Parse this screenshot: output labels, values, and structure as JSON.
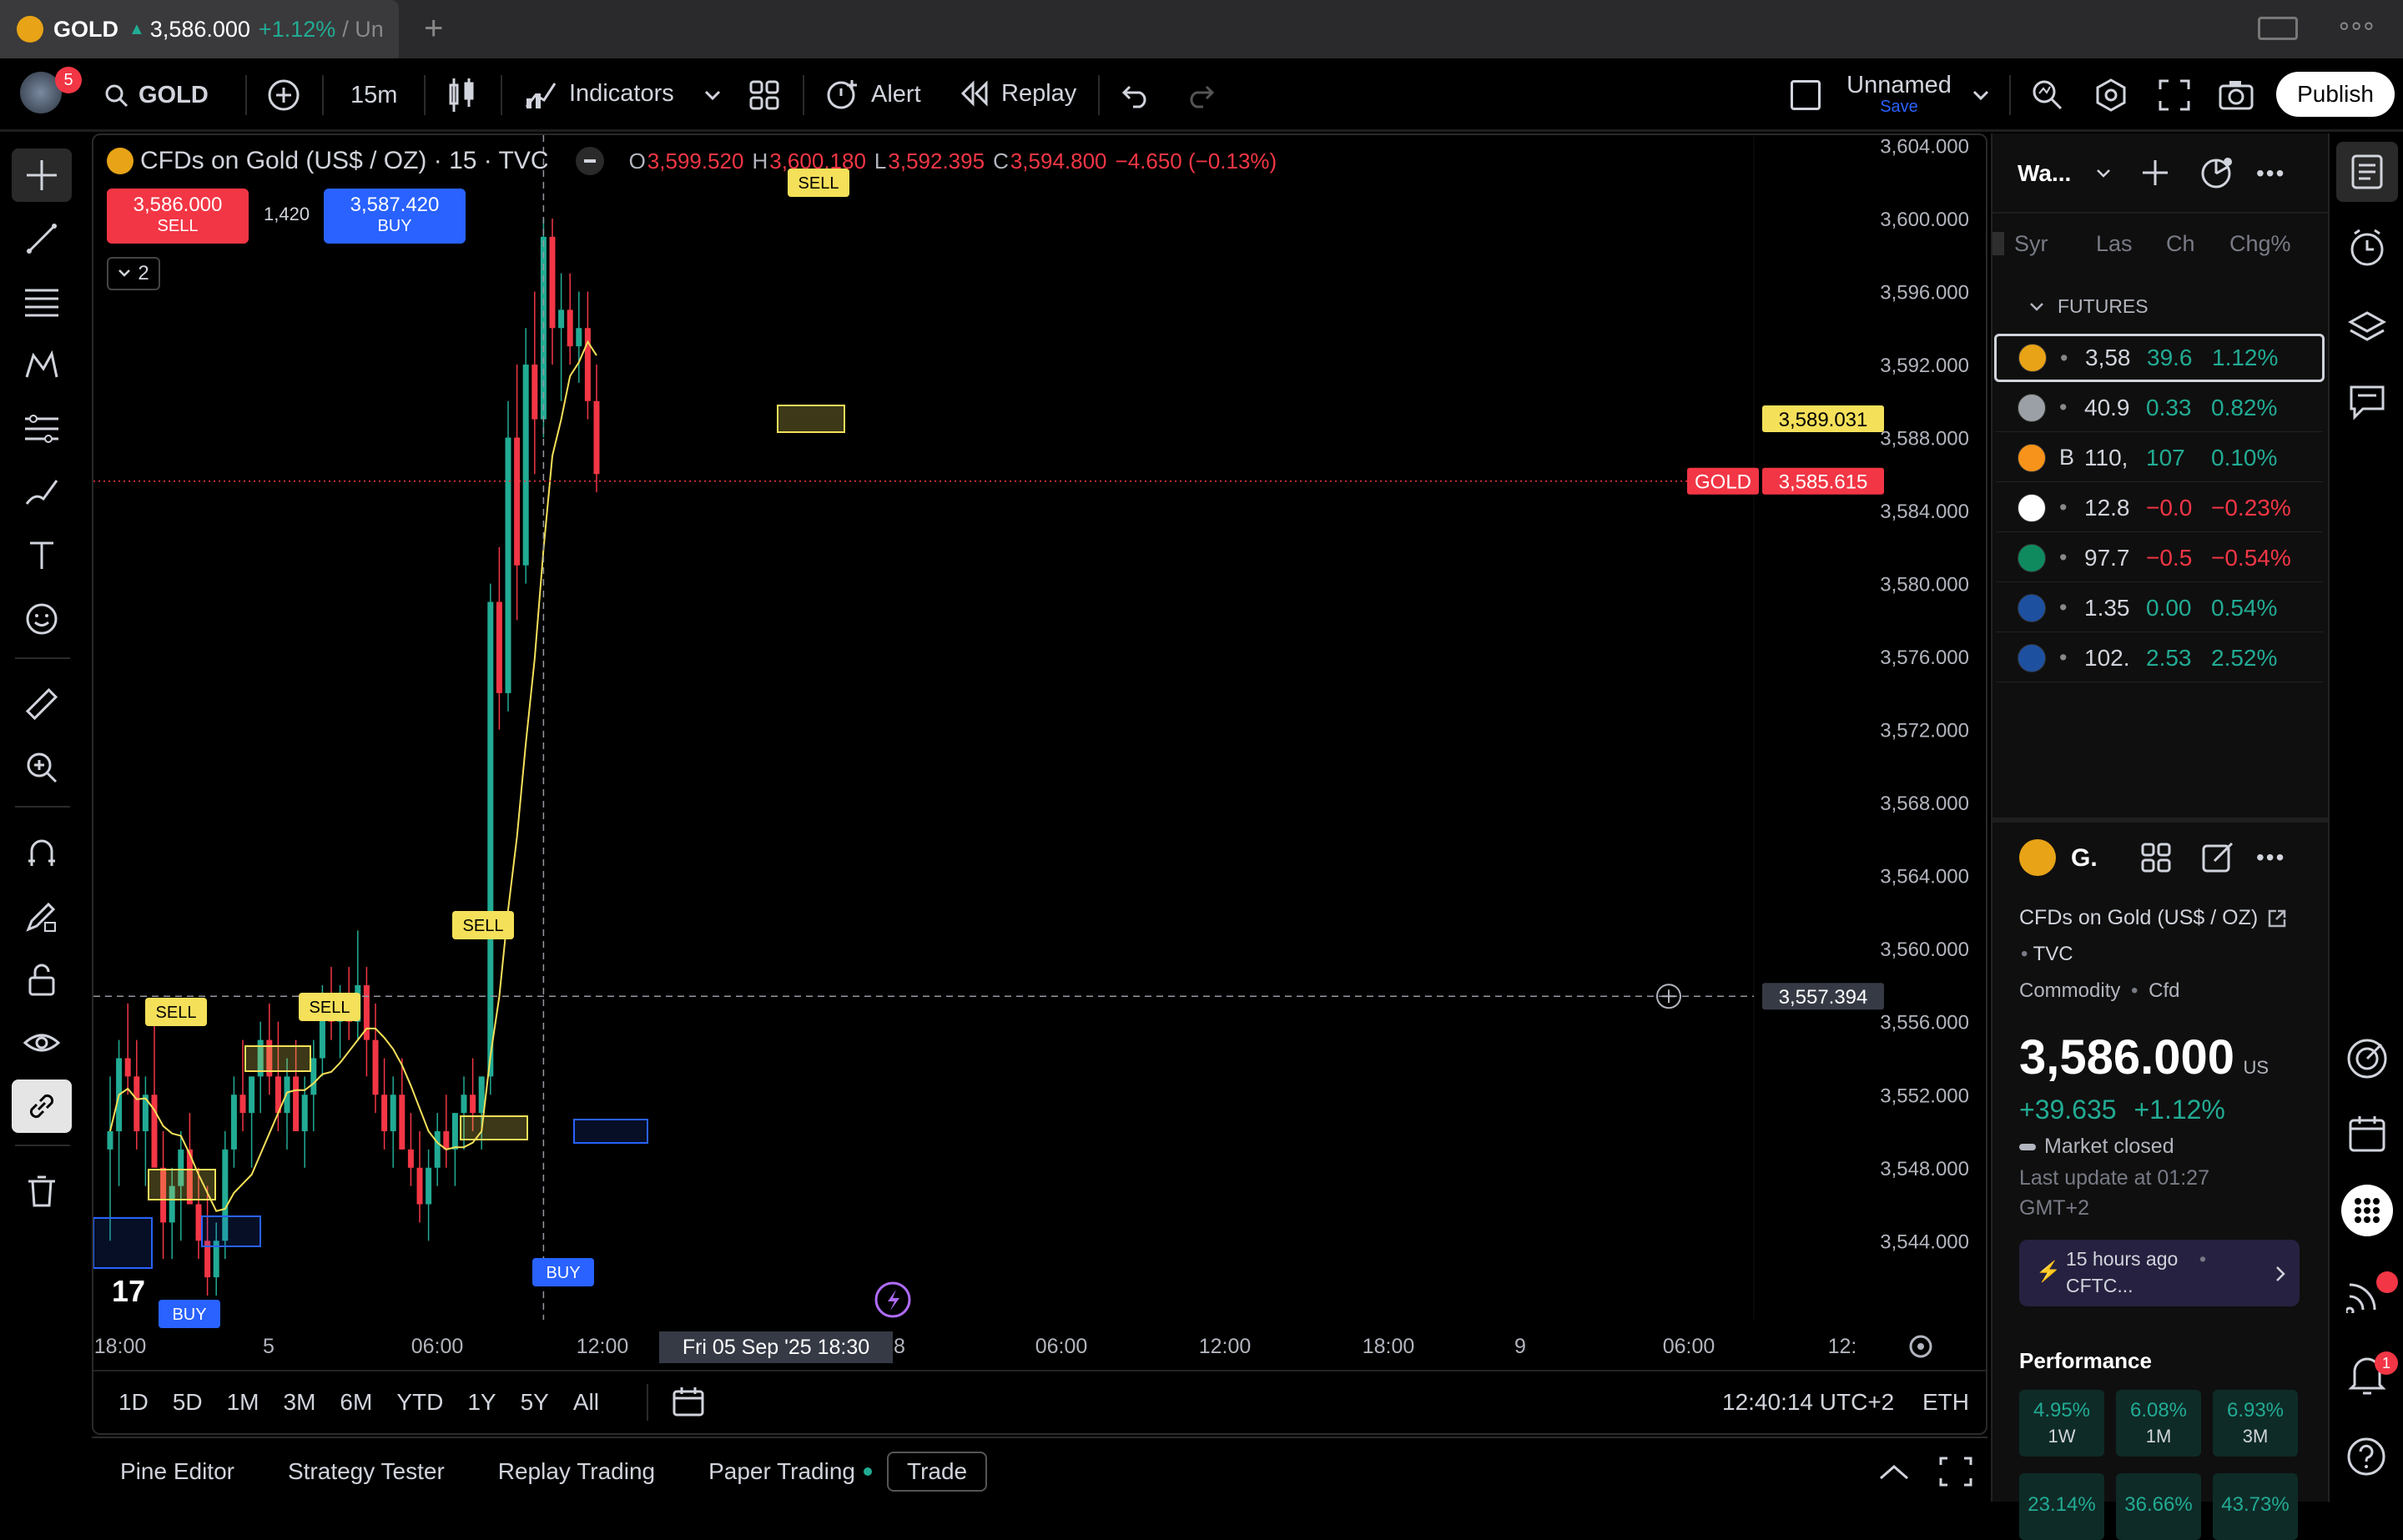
{
  "browser": {
    "tab_title_symbol": "GOLD",
    "tab_price": "3,586.000",
    "tab_change": "+1.12%",
    "tab_suffix": "/ Un",
    "new_tab": "+",
    "more": "∘∘∘"
  },
  "toolbar": {
    "notifications_count": "5",
    "symbol": "GOLD",
    "interval": "15m",
    "indicators": "Indicators",
    "alert": "Alert",
    "replay": "Replay",
    "layout_name": "Unnamed",
    "layout_save": "Save",
    "publish": "Publish"
  },
  "legend": {
    "title": "CFDs on Gold (US$ / OZ) · 15 · TVC",
    "o_label": "O",
    "o": "3,599.520",
    "h_label": "H",
    "h": "3,600.180",
    "l_label": "L",
    "l": "3,592.395",
    "c_label": "C",
    "c": "3,594.800",
    "change": "−4.650 (−0.13%)",
    "sell_price": "3,586.000",
    "sell_label": "SELL",
    "spread": "1,420",
    "buy_price": "3,587.420",
    "buy_label": "BUY",
    "collapse_count": "2"
  },
  "chart_data": {
    "type": "candlestick",
    "symbol": "GOLD",
    "interval": "15",
    "y_ticks": [
      "3,604.000",
      "3,600.000",
      "3,596.000",
      "3,592.000",
      "3,588.000",
      "3,584.000",
      "3,580.000",
      "3,576.000",
      "3,572.000",
      "3,568.000",
      "3,564.000",
      "3,560.000",
      "3,556.000",
      "3,552.000",
      "3,548.000",
      "3,544.000"
    ],
    "x_ticks": [
      "18:00",
      "5",
      "06:00",
      "12:00",
      "06:00",
      "12:00",
      "18:00",
      "9",
      "06:00",
      "12:"
    ],
    "ylim": [
      3541.5,
      3604.5
    ],
    "price_label_symbol": "GOLD",
    "last_price": "3,585.615",
    "ma_price": "3,589.031",
    "crosshair_price": "3,557.394",
    "crosshair_time": "Fri 05 Sep '25   18:30",
    "crosshair_time_tail": "8",
    "signals": [
      {
        "label": "SELL",
        "type": "sell"
      },
      {
        "label": "SELL",
        "type": "sell"
      },
      {
        "label": "SELL",
        "type": "sell"
      },
      {
        "label": "SELL",
        "type": "sell"
      },
      {
        "label": "BUY",
        "type": "buy"
      },
      {
        "label": "BUY",
        "type": "buy"
      }
    ],
    "candles": [
      [
        3549,
        3553,
        3544,
        3550
      ],
      [
        3550,
        3555,
        3547,
        3554
      ],
      [
        3554,
        3557,
        3552,
        3553
      ],
      [
        3553,
        3555,
        3549,
        3550
      ],
      [
        3550,
        3553,
        3547,
        3552
      ],
      [
        3552,
        3556,
        3549,
        3548
      ],
      [
        3548,
        3550,
        3543,
        3545
      ],
      [
        3545,
        3548,
        3543,
        3547
      ],
      [
        3547,
        3550,
        3544,
        3549
      ],
      [
        3549,
        3551,
        3546,
        3546
      ],
      [
        3546,
        3548,
        3543,
        3544
      ],
      [
        3544,
        3547,
        3541,
        3542
      ],
      [
        3542,
        3545,
        3541,
        3544
      ],
      [
        3544,
        3550,
        3543,
        3549
      ],
      [
        3549,
        3553,
        3548,
        3552
      ],
      [
        3552,
        3555,
        3550,
        3551
      ],
      [
        3551,
        3553,
        3548,
        3553
      ],
      [
        3553,
        3556,
        3551,
        3555
      ],
      [
        3555,
        3557,
        3552,
        3553
      ],
      [
        3553,
        3556,
        3550,
        3551
      ],
      [
        3551,
        3554,
        3549,
        3553
      ],
      [
        3553,
        3555,
        3550,
        3550
      ],
      [
        3550,
        3553,
        3548,
        3552
      ],
      [
        3552,
        3555,
        3550,
        3554
      ],
      [
        3554,
        3558,
        3553,
        3557
      ],
      [
        3557,
        3559,
        3555,
        3556
      ],
      [
        3556,
        3558,
        3554,
        3557
      ],
      [
        3557,
        3559,
        3555,
        3556
      ],
      [
        3556,
        3561,
        3555,
        3558
      ],
      [
        3558,
        3559,
        3553,
        3555
      ],
      [
        3555,
        3557,
        3551,
        3552
      ],
      [
        3552,
        3554,
        3549,
        3550
      ],
      [
        3550,
        3553,
        3548,
        3552
      ],
      [
        3552,
        3554,
        3549,
        3549
      ],
      [
        3549,
        3551,
        3547,
        3548
      ],
      [
        3548,
        3550,
        3545,
        3546
      ],
      [
        3546,
        3549,
        3544,
        3548
      ],
      [
        3548,
        3551,
        3547,
        3550
      ],
      [
        3550,
        3552,
        3548,
        3549
      ],
      [
        3549,
        3551,
        3547,
        3551
      ],
      [
        3551,
        3553,
        3549,
        3552
      ],
      [
        3552,
        3554,
        3550,
        3551
      ],
      [
        3551,
        3553,
        3549,
        3553
      ],
      [
        3553,
        3580,
        3552,
        3579
      ],
      [
        3579,
        3582,
        3572,
        3574
      ],
      [
        3574,
        3590,
        3573,
        3588
      ],
      [
        3588,
        3592,
        3578,
        3581
      ],
      [
        3581,
        3594,
        3580,
        3592
      ],
      [
        3592,
        3596,
        3586,
        3589
      ],
      [
        3589,
        3600,
        3588,
        3599
      ],
      [
        3599,
        3600,
        3592,
        3594
      ],
      [
        3594,
        3597,
        3590,
        3595
      ],
      [
        3595,
        3597,
        3592,
        3593
      ],
      [
        3593,
        3596,
        3591,
        3594
      ],
      [
        3594,
        3596,
        3589,
        3590
      ],
      [
        3590,
        3592,
        3585,
        3586
      ]
    ],
    "ma_series": "yellow"
  },
  "time_ranges": [
    "1D",
    "5D",
    "1M",
    "3M",
    "6M",
    "YTD",
    "1Y",
    "5Y",
    "All"
  ],
  "clock": "12:40:14 UTC+2",
  "session": "ETH",
  "bottom_tabs": [
    "Pine Editor",
    "Strategy Tester",
    "Replay Trading",
    "Paper Trading",
    "Trade"
  ],
  "watchlist": {
    "title": "Wa...",
    "col_symbol": "Syr",
    "col_last": "Las",
    "col_ch": "Ch",
    "col_chgp": "Chg%",
    "group": "FUTURES",
    "rows": [
      {
        "sym": "",
        "last": "3,58",
        "ch": "39.6",
        "chgp": "1.12%",
        "color": "#22ab94",
        "icon_bg": "#e8a317"
      },
      {
        "sym": "",
        "last": "40.9",
        "ch": "0.33",
        "chgp": "0.82%",
        "color": "#22ab94",
        "icon_bg": "#9aa0a6"
      },
      {
        "sym": "B",
        "last": "110,",
        "ch": "107",
        "chgp": "0.10%",
        "color": "#22ab94",
        "icon_bg": "#f7931a"
      },
      {
        "sym": "",
        "last": "12.8",
        "ch": "−0.0",
        "chgp": "−0.23%",
        "color": "#f23645",
        "icon_bg": "#ffffff"
      },
      {
        "sym": "",
        "last": "97.7",
        "ch": "−0.5",
        "chgp": "−0.54%",
        "color": "#f23645",
        "icon_bg": "#0f8a5f"
      },
      {
        "sym": "",
        "last": "1.35",
        "ch": "0.00",
        "chgp": "0.54%",
        "color": "#22ab94",
        "icon_bg": "#1e50a0"
      },
      {
        "sym": "",
        "last": "102.",
        "ch": "2.53",
        "chgp": "2.52%",
        "color": "#22ab94",
        "icon_bg": "#1e50a0"
      }
    ]
  },
  "details": {
    "short_name": "G.",
    "full_name": "CFDs on Gold (US$ / OZ)",
    "exchange": "TVC",
    "category": "Commodity",
    "type": "Cfd",
    "price": "3,586.000",
    "currency": "US",
    "change": "+39.635",
    "change_pct": "+1.12%",
    "market_status": "Market closed",
    "last_update": "Last update at 01:27",
    "timezone": "GMT+2",
    "news_time": "15 hours ago",
    "news_source": "CFTC...",
    "performance_title": "Performance",
    "performance": [
      {
        "value": "4.95%",
        "period": "1W"
      },
      {
        "value": "6.08%",
        "period": "1M"
      },
      {
        "value": "6.93%",
        "period": "3M"
      },
      {
        "value": "23.14%",
        "period": ""
      },
      {
        "value": "36.66%",
        "period": ""
      },
      {
        "value": "43.73%",
        "period": ""
      }
    ]
  },
  "rightbar": {
    "notification_count": "1"
  }
}
